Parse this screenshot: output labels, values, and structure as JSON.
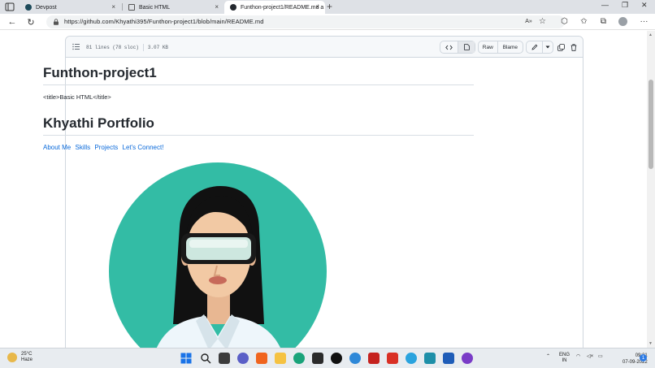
{
  "browser": {
    "tabs": [
      {
        "title": "Devpost",
        "active": false
      },
      {
        "title": "Basic HTML",
        "active": false
      },
      {
        "title": "Funthon-project1/README.md a",
        "active": true
      }
    ],
    "new_tab": "+",
    "close_glyph": "×",
    "window_controls": [
      "—",
      "❐",
      "✕"
    ],
    "nav": {
      "back": "←",
      "reload": "↻"
    },
    "url": "https://github.com/Khyathi395/Funthon-project1/blob/main/README.md",
    "toolbar_icons": [
      "read-aloud-icon",
      "favorite-add-icon",
      "extensions-icon",
      "favorites-icon",
      "collections-icon",
      "profile-icon",
      "more-icon"
    ]
  },
  "file_header": {
    "lines": "81 lines (78 sloc)",
    "size": "3.07 KB",
    "raw_label": "Raw",
    "blame_label": "Blame"
  },
  "readme": {
    "title1": "Funthon-project1",
    "title_tag_text": "<title>Basic HTML</title>",
    "title2": "Khyathi Portfolio",
    "nav_links": [
      "About Me",
      "Skills",
      "Projects",
      "Let's Connect!"
    ]
  },
  "taskbar": {
    "temperature": "25°C",
    "condition": "Haze",
    "language_top": "ENG",
    "language_bottom": "IN",
    "time": "09:21",
    "date": "07-09-2022",
    "notification_count": "1"
  },
  "colors": {
    "avatar_bg": "#33bca5",
    "hair": "#111111",
    "skin": "#f2c9a4",
    "link": "#0969da"
  }
}
